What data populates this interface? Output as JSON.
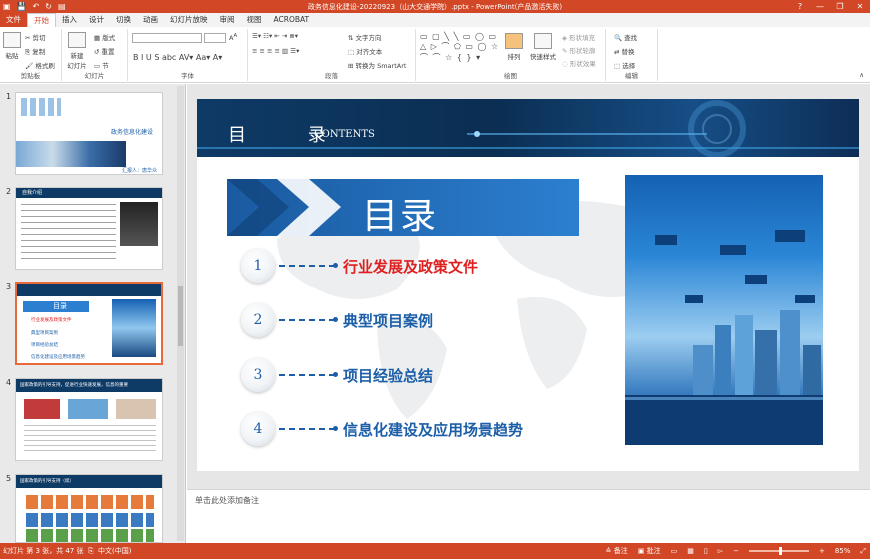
{
  "titlebar": {
    "title": "政务信息化建设-20220923（山大交通学院）.pptx - PowerPoint(产品激活失败)",
    "help": "?",
    "minimize": "—",
    "restore": "❐",
    "close": "✕"
  },
  "tabs": [
    "文件",
    "开始",
    "插入",
    "设计",
    "切换",
    "动画",
    "幻灯片放映",
    "审阅",
    "视图",
    "ACROBAT"
  ],
  "ribbon": {
    "clipboard": {
      "label": "剪贴板",
      "paste": "粘贴",
      "cut": "剪切",
      "copy": "复制",
      "format_painter": "格式刷"
    },
    "slides": {
      "label": "幻灯片",
      "new_slide": "新建\n幻灯片",
      "layout": "版式",
      "reset": "重置",
      "section": "节"
    },
    "font": {
      "label": "字体"
    },
    "paragraph": {
      "label": "段落",
      "text_direction": "文字方向",
      "align_text": "对齐文本",
      "smartart": "转换为 SmartArt"
    },
    "drawing": {
      "label": "绘图",
      "arrange": "排列",
      "quick_styles": "快速样式",
      "shape_fill": "形状填充",
      "shape_outline": "形状轮廓",
      "shape_effects": "形状效果"
    },
    "editing": {
      "label": "编辑",
      "find": "查找",
      "replace": "替换",
      "select": "选择"
    }
  },
  "thumbnails": [
    {
      "num": "1",
      "title": "政务信息化建设",
      "sub": "汇报人：唐华众"
    },
    {
      "num": "2",
      "title": "自我介绍"
    },
    {
      "num": "3",
      "title": "目录",
      "items": [
        "行业发展及政策文件",
        "典型项目案例",
        "项目经验总结",
        "信息化建设及应用场景趋势"
      ]
    },
    {
      "num": "4",
      "title": "国家政策的引导支持，促进行业快速发展，信息的重要"
    },
    {
      "num": "5",
      "title": "国家政策的引导支持（续）"
    }
  ],
  "slide": {
    "header_title": "目 录",
    "header_en": "CONTENTS",
    "big_title": "目录",
    "items": [
      {
        "num": "1",
        "text": "行业发展及政策文件",
        "highlight": true
      },
      {
        "num": "2",
        "text": "典型项目案例",
        "highlight": false
      },
      {
        "num": "3",
        "text": "项目经验总结",
        "highlight": false
      },
      {
        "num": "4",
        "text": "信息化建设及应用场景趋势",
        "highlight": false
      }
    ]
  },
  "notes": {
    "placeholder": "单击此处添加备注"
  },
  "status": {
    "slide_info": "幻灯片 第 3 张，共 47 张",
    "lang": "中文(中国)",
    "notes": "备注",
    "comments": "批注",
    "zoom": "85%"
  },
  "colors": {
    "accent": "#d24726",
    "slide_blue": "#1c5fa8",
    "highlight_red": "#e02020"
  }
}
